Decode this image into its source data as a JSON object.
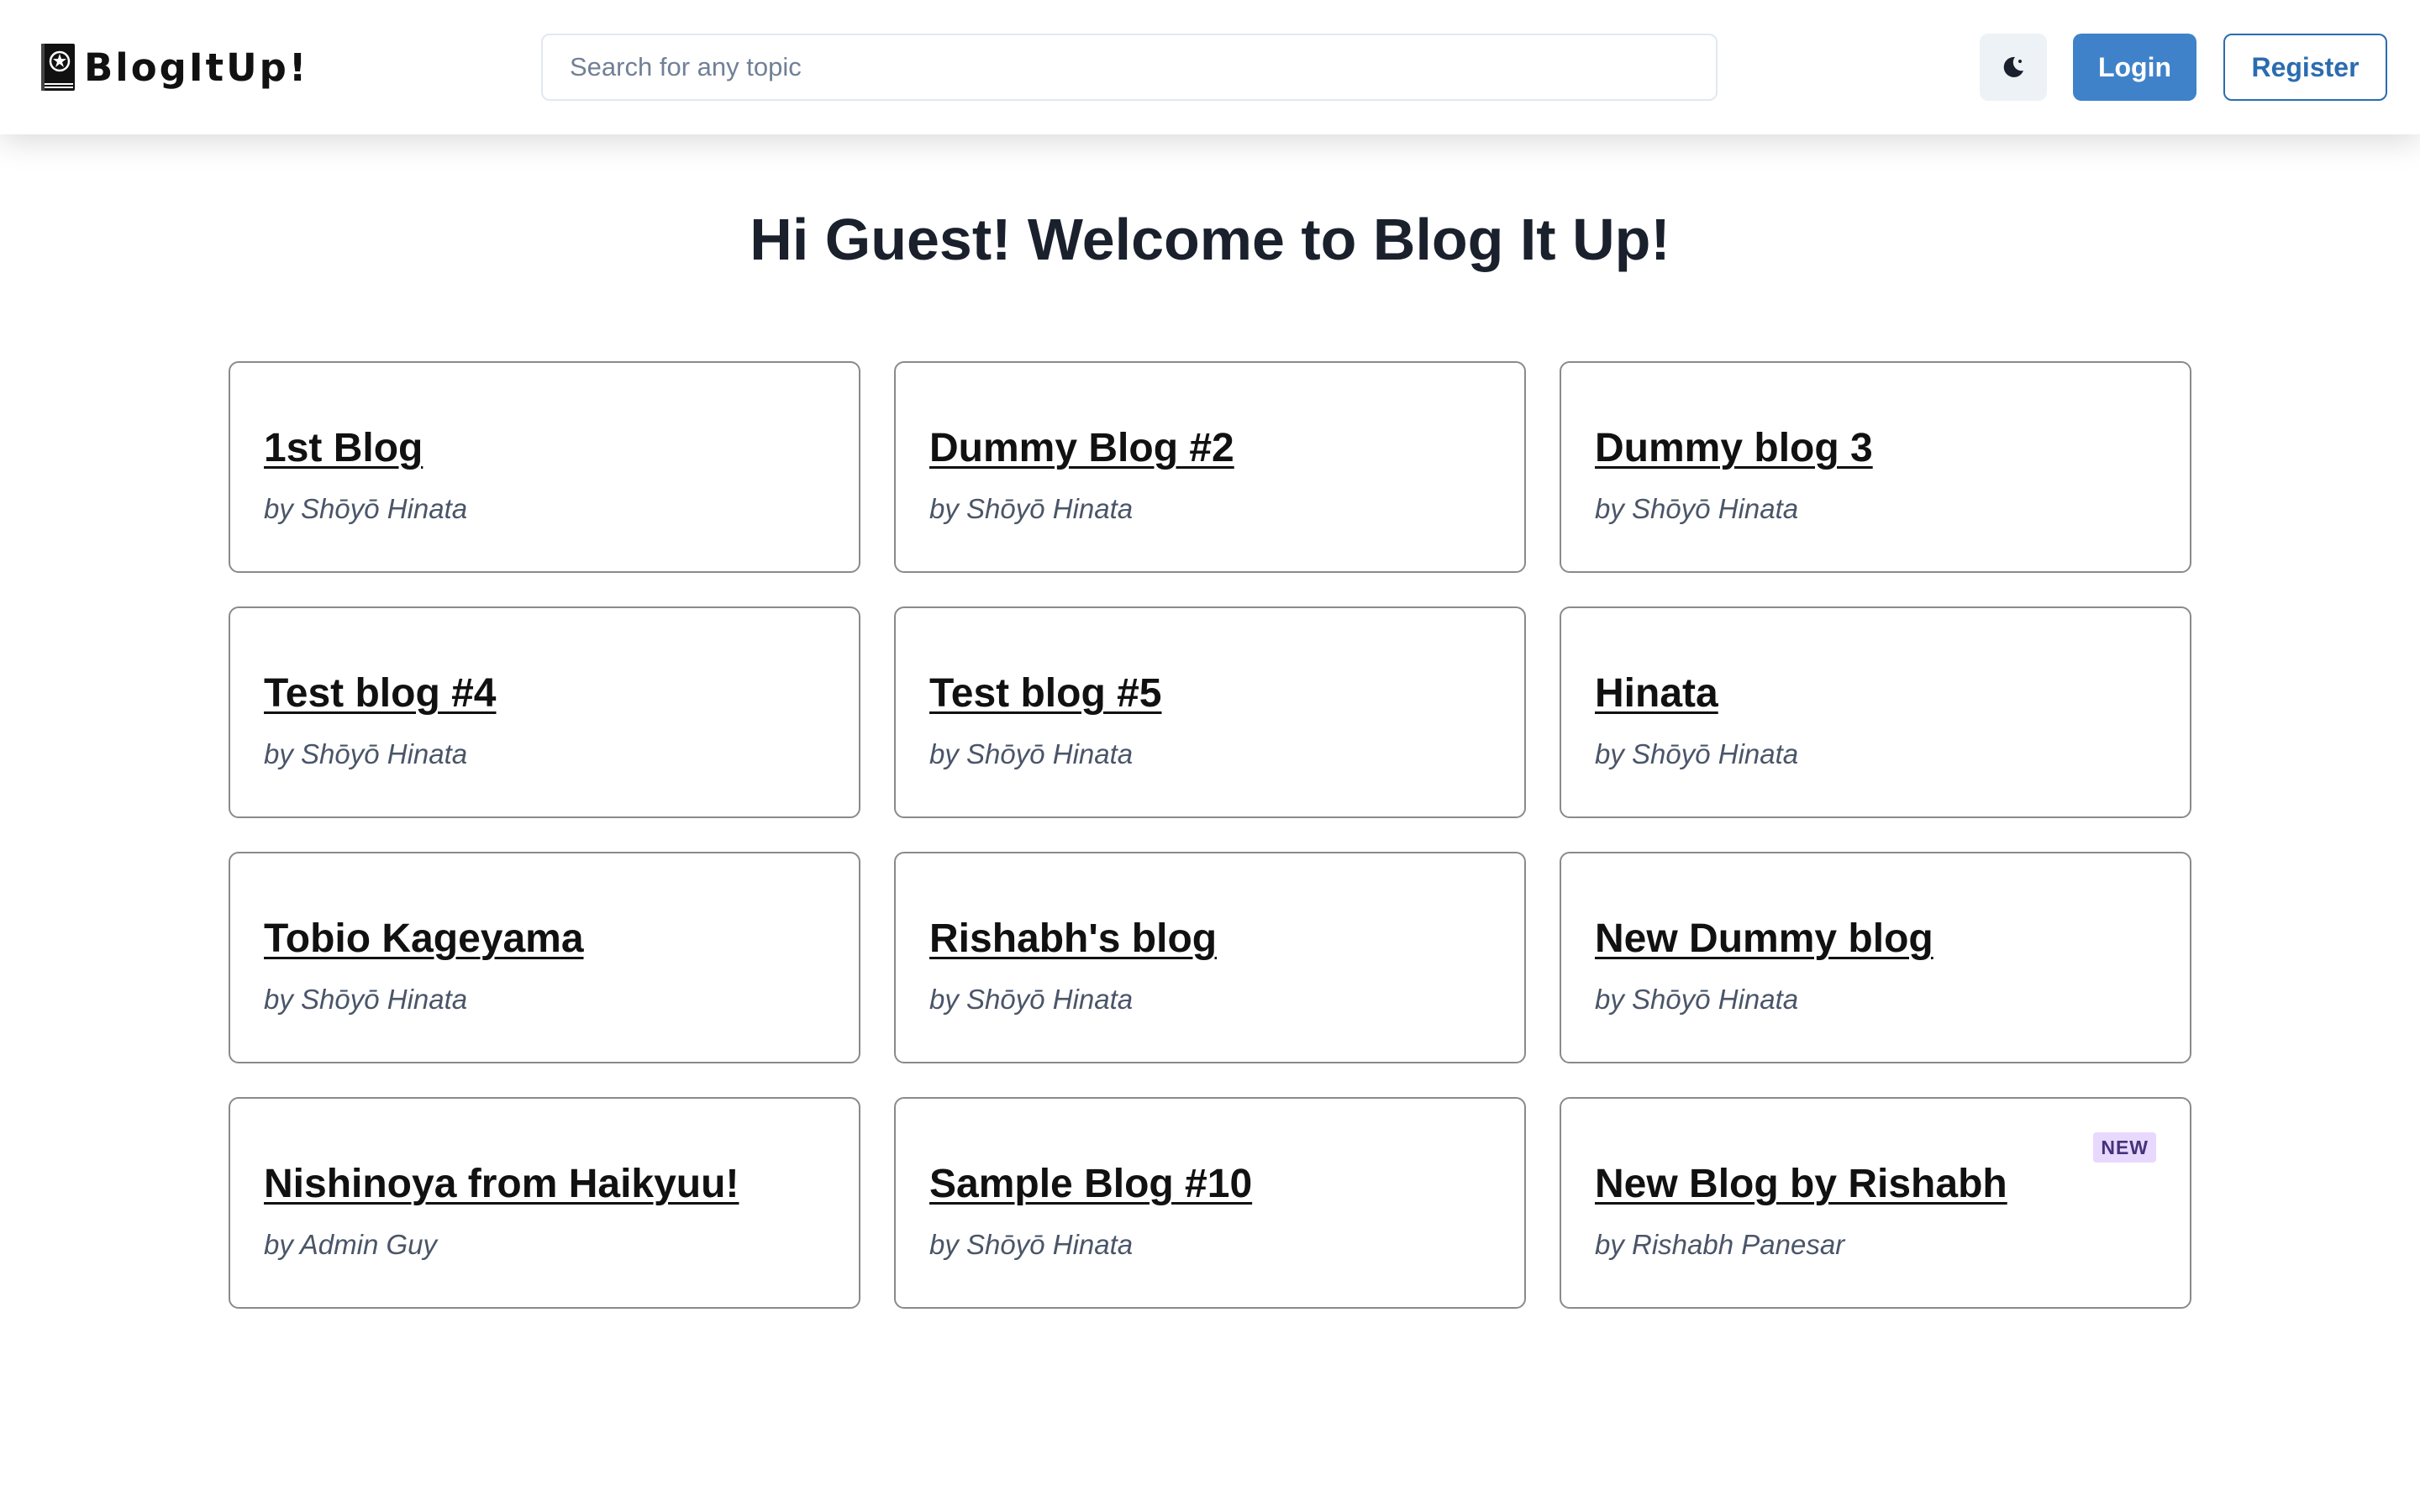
{
  "header": {
    "brand": "BlogItUp!",
    "search": {
      "placeholder": "Search for any topic",
      "value": ""
    },
    "theme_toggle_icon": "moon-icon",
    "login_label": "Login",
    "register_label": "Register"
  },
  "main": {
    "welcome": "Hi Guest! Welcome to Blog It Up!",
    "blogs": [
      {
        "title": "1st Blog",
        "author": "by Shōyō Hinata"
      },
      {
        "title": "Dummy Blog #2",
        "author": "by Shōyō Hinata"
      },
      {
        "title": "Dummy blog 3",
        "author": "by Shōyō Hinata"
      },
      {
        "title": "Test blog #4",
        "author": "by Shōyō Hinata"
      },
      {
        "title": "Test blog #5",
        "author": "by Shōyō Hinata"
      },
      {
        "title": "Hinata",
        "author": "by Shōyō Hinata"
      },
      {
        "title": "Tobio Kageyama",
        "author": "by Shōyō Hinata"
      },
      {
        "title": "Rishabh's blog",
        "author": "by Shōyō Hinata"
      },
      {
        "title": "New Dummy blog",
        "author": "by Shōyō Hinata"
      },
      {
        "title": "Nishinoya from Haikyuu!",
        "author": "by Admin Guy"
      },
      {
        "title": "Sample Blog #10",
        "author": "by Shōyō Hinata"
      },
      {
        "title": "New Blog by Rishabh",
        "author": "by Rishabh Panesar",
        "badge": "NEW"
      }
    ]
  },
  "colors": {
    "primary": "#3f82c9",
    "register_outline": "#2b6cb0",
    "badge_bg": "#e9d8fd",
    "badge_text": "#44337a",
    "card_border": "#8a8a8a"
  }
}
